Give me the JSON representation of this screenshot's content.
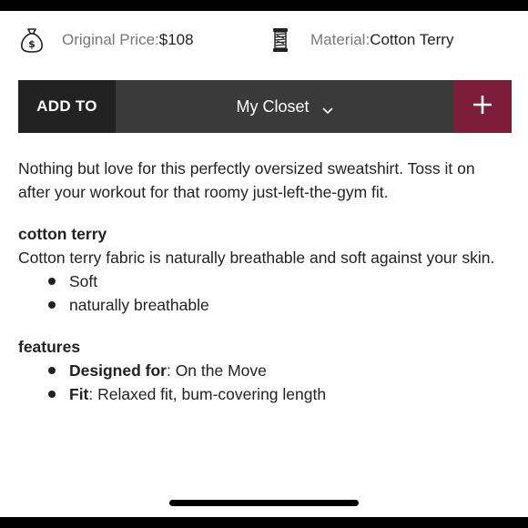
{
  "info": {
    "price_label": "Original Price: ",
    "price_value": "$108",
    "price_icon": "money-bag-icon",
    "material_label": "Material: ",
    "material_value": "Cotton Terry",
    "material_icon": "thread-spool-icon"
  },
  "add_bar": {
    "add_to_label": "ADD TO",
    "closet_value": "My Closet",
    "plus_icon": "plus-icon",
    "accent_color": "#7b1d3a"
  },
  "description": "Nothing but love for this perfectly oversized sweatshirt. Toss it on after your workout for that roomy just-left-the-gym fit.",
  "fabric": {
    "heading": "cotton terry",
    "text": "Cotton terry fabric is naturally breathable and soft against your skin.",
    "bullets": [
      "Soft",
      "naturally breathable"
    ]
  },
  "features": {
    "heading": "features",
    "items": [
      {
        "key": "Designed for",
        "value": ": On the Move"
      },
      {
        "key": "Fit",
        "value": ": Relaxed fit, bum-covering length"
      }
    ]
  }
}
